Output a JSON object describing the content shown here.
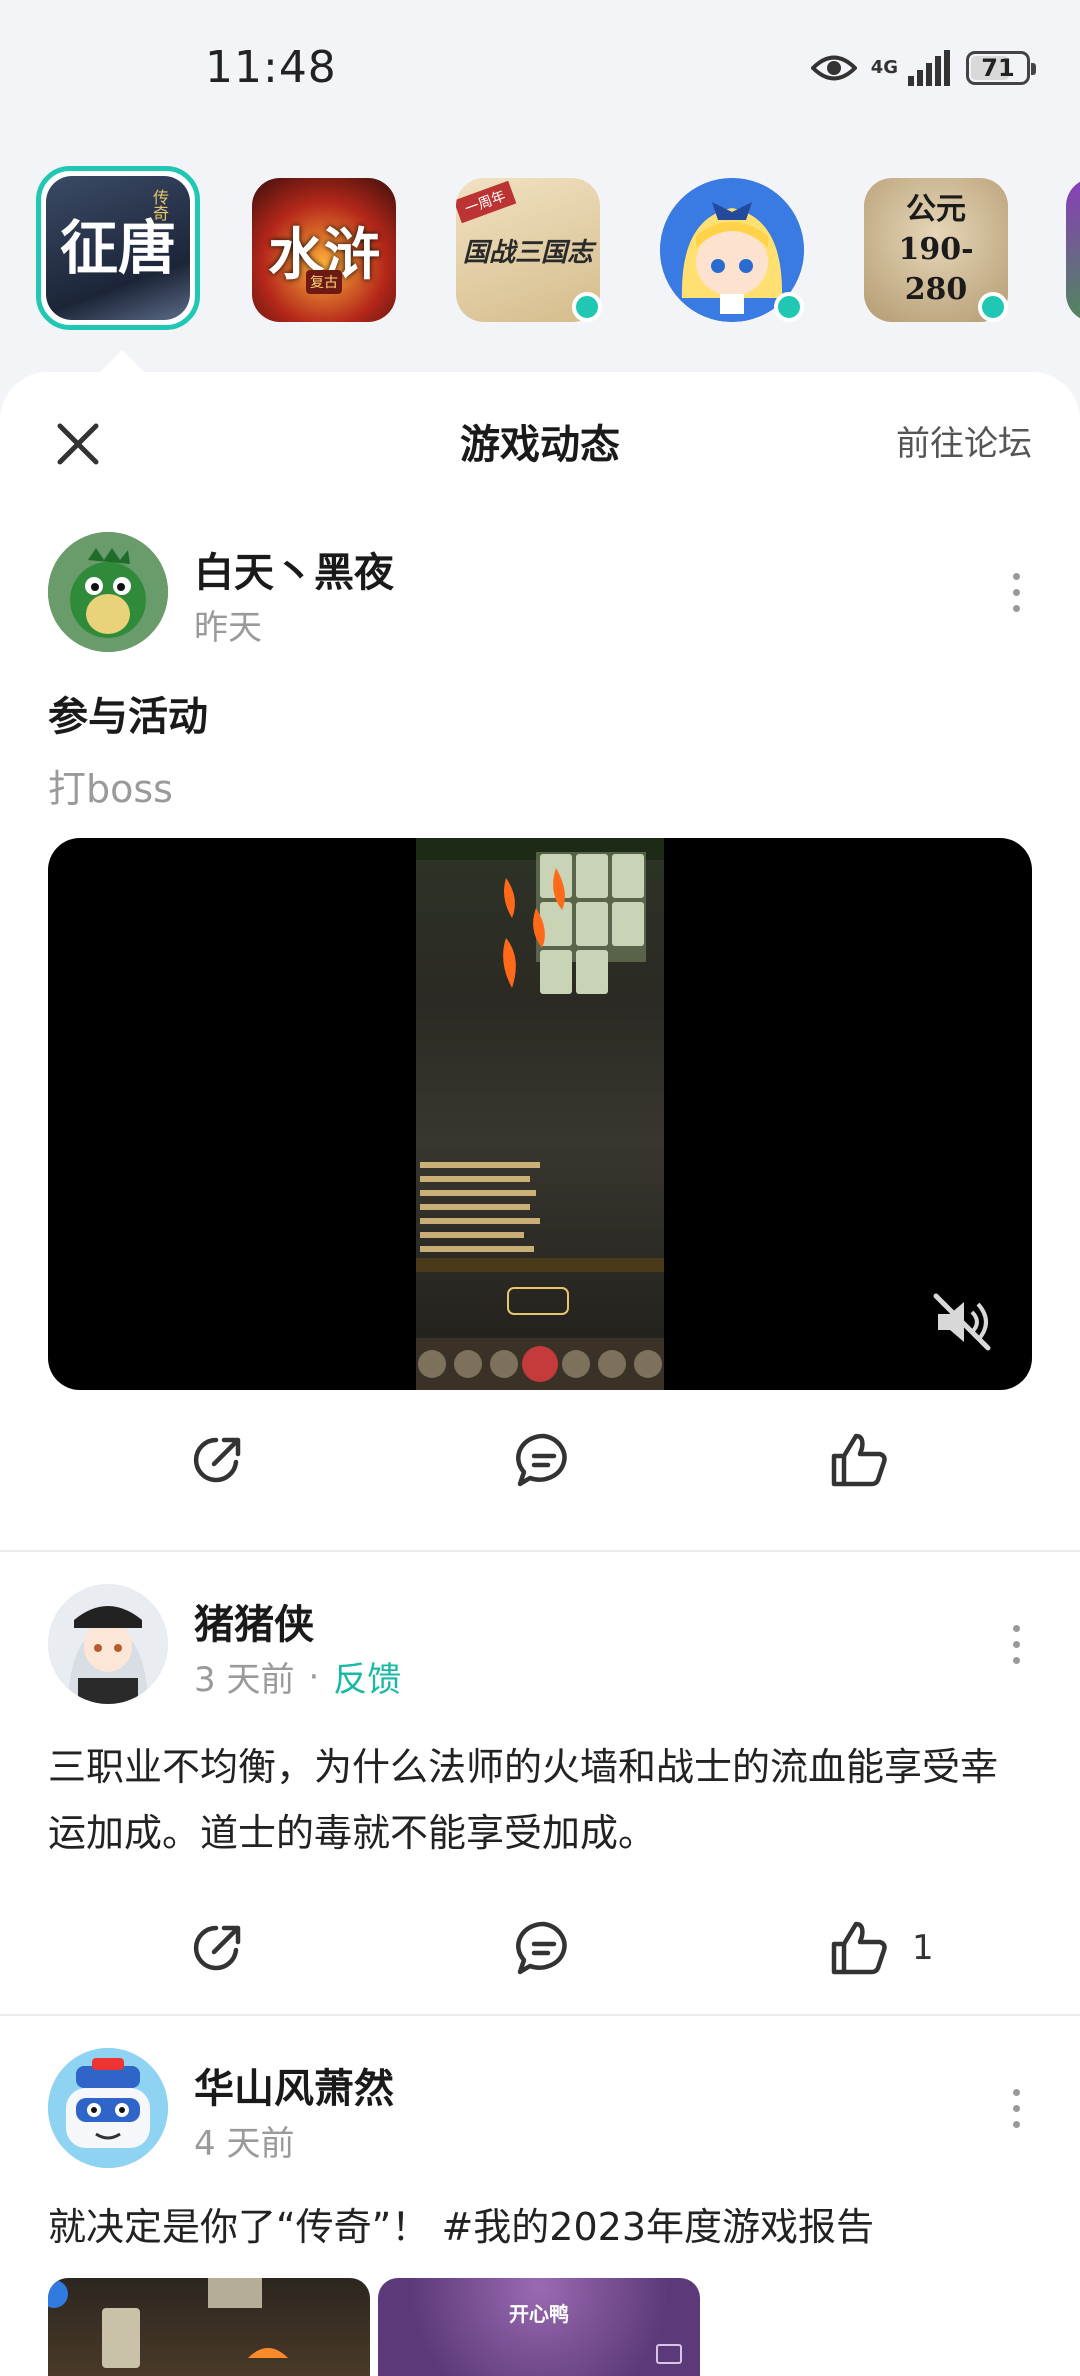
{
  "status_bar": {
    "time": "11:48",
    "network": "4G",
    "battery": 71,
    "icons": [
      "eye-icon",
      "signal-icon",
      "battery-icon"
    ]
  },
  "games": [
    {
      "name": "征唐",
      "badge": "传奇",
      "selected": true,
      "online": false
    },
    {
      "name": "水浒",
      "badge": "复古",
      "selected": false,
      "online": false
    },
    {
      "name": "国战三国志",
      "badge": "一周年",
      "selected": false,
      "online": true
    },
    {
      "name": "",
      "badge": "",
      "selected": false,
      "online": true
    },
    {
      "name": "公元 190-280",
      "badge": "",
      "selected": false,
      "online": true
    }
  ],
  "sheet": {
    "title": "游戏动态",
    "forum_link": "前往论坛",
    "close_icon": "close-icon"
  },
  "posts": [
    {
      "author": "白天丶黑夜",
      "time": "昨天",
      "tag": "",
      "title": "参与活动",
      "subtitle": "打boss",
      "has_video": true,
      "muted": true,
      "likes": ""
    },
    {
      "author": "猪猪侠",
      "time": "3 天前",
      "tag": "反馈",
      "body": "三职业不均衡，为什么法师的火墙和战士的流血能享受幸运加成。道士的毒就不能享受加成。",
      "likes": "1"
    },
    {
      "author": "华山风萧然",
      "time": "4 天前",
      "tag": "",
      "body": "就决定是你了“传奇”！ #我的2023年度游戏报告",
      "thumb_caption": "开心鸭"
    }
  ],
  "colors": {
    "accent": "#20c7b2",
    "tag": "#1bb9a5",
    "background": "#f3f4f7"
  }
}
